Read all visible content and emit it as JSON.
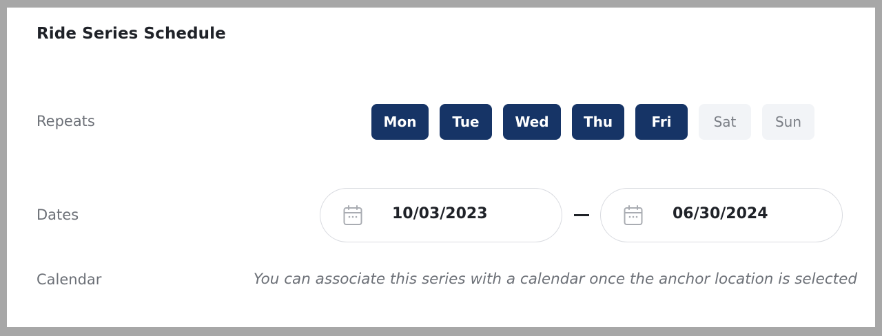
{
  "section": {
    "title": "Ride Series Schedule"
  },
  "repeats": {
    "label": "Repeats",
    "days": [
      {
        "label": "Mon",
        "selected": true
      },
      {
        "label": "Tue",
        "selected": true
      },
      {
        "label": "Wed",
        "selected": true
      },
      {
        "label": "Thu",
        "selected": true
      },
      {
        "label": "Fri",
        "selected": true
      },
      {
        "label": "Sat",
        "selected": false
      },
      {
        "label": "Sun",
        "selected": false
      }
    ]
  },
  "dates": {
    "label": "Dates",
    "start": "10/03/2023",
    "end": "06/30/2024",
    "icon": "calendar-icon"
  },
  "calendar": {
    "label": "Calendar",
    "note": "You can associate this series with a calendar once the anchor location is selected"
  },
  "colors": {
    "selected_day": "#163466",
    "unselected_day": "#f2f4f7",
    "label_text": "#6c7077"
  }
}
